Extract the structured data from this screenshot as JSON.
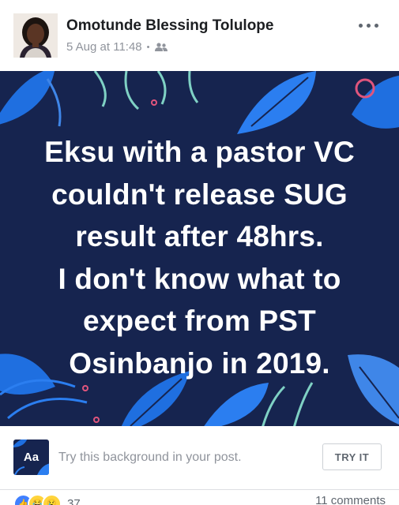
{
  "post": {
    "author": "Omotunde Blessing Tolulope",
    "timestamp": "5 Aug at 11:48",
    "separator": "•",
    "privacy_icon": "friends-icon",
    "more_icon": "more-horizontal-icon",
    "text_lines": [
      "Eksu with a pastor VC",
      "couldn't release SUG",
      "result after 48hrs.",
      "I don't know what to",
      "expect from PST",
      "Osinbanjo in 2019."
    ],
    "background_color": "#16244f",
    "accent_color": "#1f6fe0"
  },
  "suggestion": {
    "tile_label": "Aa",
    "text": "Try this background in your post.",
    "button_label": "TRY IT"
  },
  "footer": {
    "reactions": [
      "like-icon",
      "haha-icon",
      "sad-icon"
    ],
    "reaction_count": "37",
    "comments": "11 comments"
  }
}
